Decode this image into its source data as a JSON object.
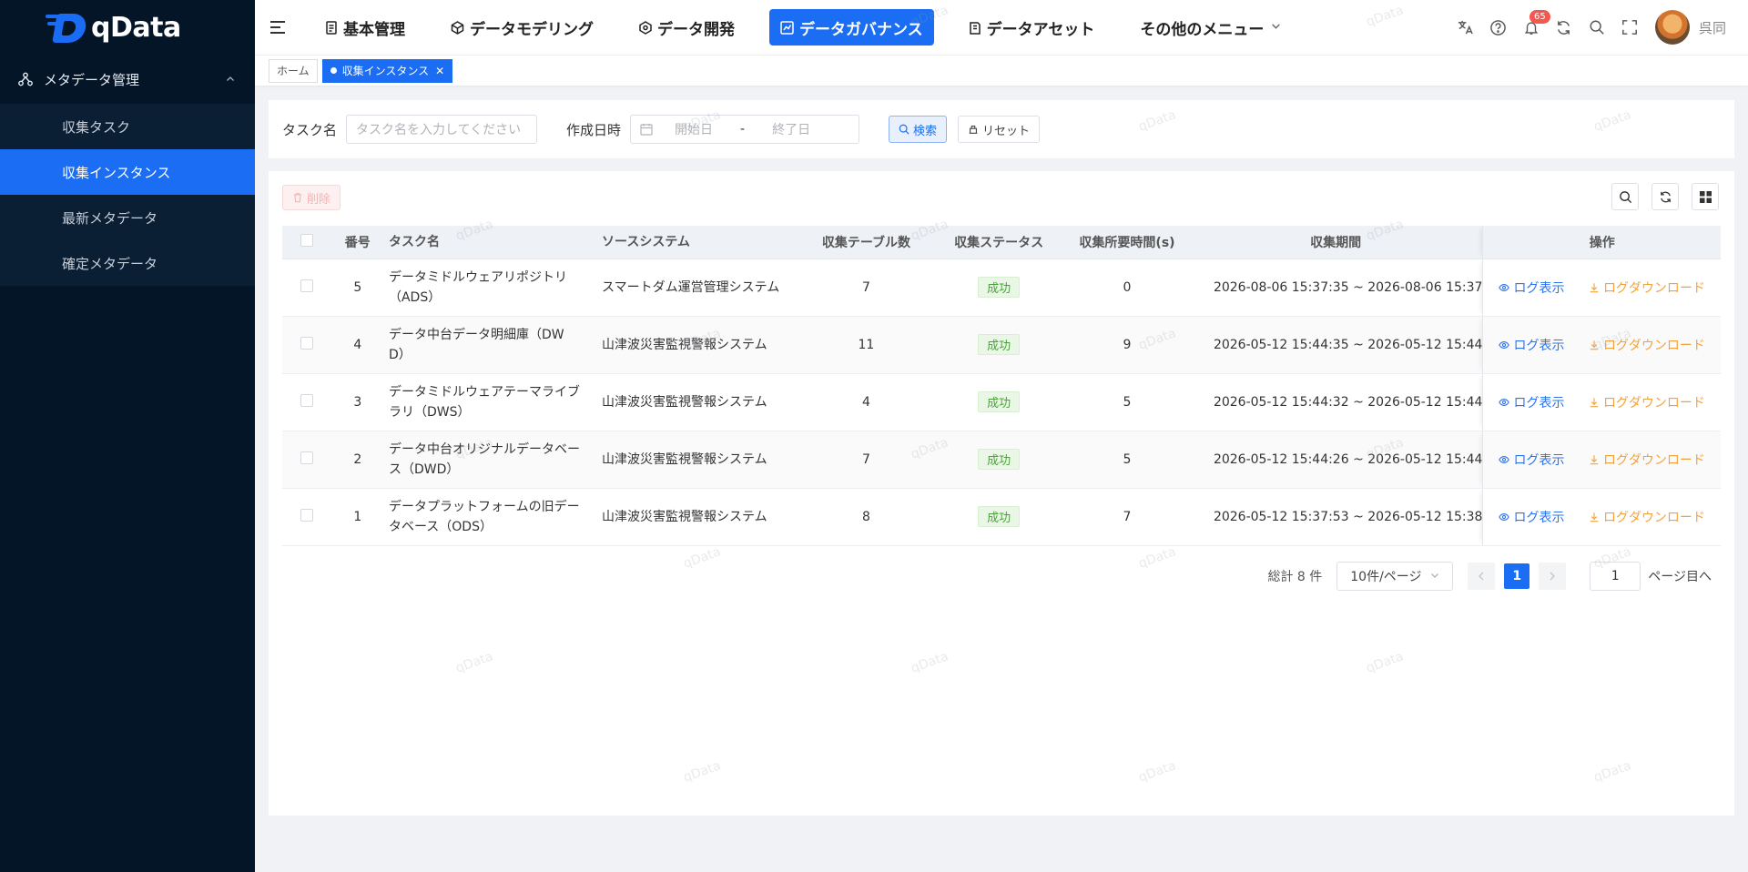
{
  "app": {
    "name": "qData",
    "brand_color": "#1b6df3"
  },
  "sidebar": {
    "group_label": "メタデータ管理",
    "group_icon": "hierarchy-icon",
    "items": [
      {
        "label": "収集タスク",
        "active": false
      },
      {
        "label": "収集インスタンス",
        "active": true
      },
      {
        "label": "最新メタデータ",
        "active": false
      },
      {
        "label": "確定メタデータ",
        "active": false
      }
    ]
  },
  "header": {
    "nav": [
      {
        "label": "基本管理",
        "icon": "doc-icon"
      },
      {
        "label": "データモデリング",
        "icon": "cube-icon"
      },
      {
        "label": "データ開発",
        "icon": "hexagon-icon"
      },
      {
        "label": "データガバナンス",
        "icon": "chart-icon",
        "active": true
      },
      {
        "label": "データアセット",
        "icon": "book-icon"
      },
      {
        "label": "その他のメニュー",
        "icon": "",
        "has_caret": true
      }
    ],
    "notification_count": "65",
    "username": "呉同"
  },
  "tabs": {
    "home": "ホーム",
    "current": "収集インスタンス"
  },
  "search": {
    "task_label": "タスク名",
    "task_placeholder": "タスク名を入力してください",
    "date_label": "作成日時",
    "start_placeholder": "開始日",
    "separator": "-",
    "end_placeholder": "終了日",
    "search_btn": "検索",
    "reset_btn": "リセット"
  },
  "toolbar": {
    "delete_btn": "削除"
  },
  "table": {
    "columns": [
      "番号",
      "タスク名",
      "ソースシステム",
      "収集テーブル数",
      "収集ステータス",
      "収集所要時間(s)",
      "収集期間",
      "操作"
    ],
    "rows": [
      {
        "no": "5",
        "task_line1": "データミドルウェアリポジトリ",
        "task_line2": "（ADS）",
        "source": "スマートダム運営管理システム",
        "tables": "7",
        "status": "成功",
        "duration": "0",
        "period": "2026-08-06 15:37:35 ~ 2026-08-06 15:37"
      },
      {
        "no": "4",
        "task_line1": "データ中台データ明細庫（DW",
        "task_line2": "D）",
        "source": "山津波災害監視警報システム",
        "tables": "11",
        "status": "成功",
        "duration": "9",
        "period": "2026-05-12 15:44:35 ~ 2026-05-12 15:44"
      },
      {
        "no": "3",
        "task_line1": "データミドルウェアテーマライブ",
        "task_line2": "ラリ（DWS）",
        "source": "山津波災害監視警報システム",
        "tables": "4",
        "status": "成功",
        "duration": "5",
        "period": "2026-05-12 15:44:32 ~ 2026-05-12 15:44"
      },
      {
        "no": "2",
        "task_line1": "データ中台オリジナルデータベー",
        "task_line2": "ス（DWD）",
        "source": "山津波災害監視警報システム",
        "tables": "7",
        "status": "成功",
        "duration": "5",
        "period": "2026-05-12 15:44:26 ~ 2026-05-12 15:44"
      },
      {
        "no": "1",
        "task_line1": "データプラットフォームの旧デー",
        "task_line2": "タベース（ODS）",
        "source": "山津波災害監視警報システム",
        "tables": "8",
        "status": "成功",
        "duration": "7",
        "period": "2026-05-12 15:37:53 ~ 2026-05-12 15:38"
      }
    ],
    "op_view": "ログ表示",
    "op_download": "ログダウンロード"
  },
  "pagination": {
    "total": "総計 8 件",
    "page_size": "10件/ページ",
    "current_page": "1",
    "jump_value": "1",
    "jump_label": "ページ目へ"
  },
  "watermark": "qData"
}
